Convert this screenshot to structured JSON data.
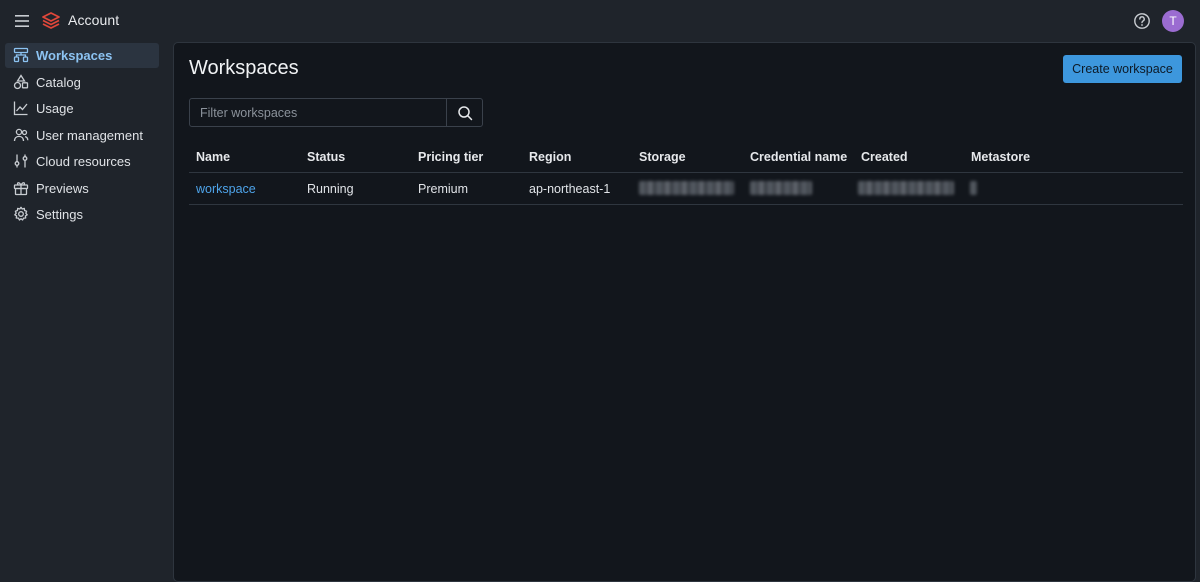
{
  "header": {
    "title": "Account",
    "menu_icon": "hamburger-menu-icon",
    "logo_icon": "stacked-layers-logo",
    "help_icon": "help-circle-icon",
    "avatar_initial": "T",
    "avatar_color": "#9b6cd1"
  },
  "sidebar": {
    "items": [
      {
        "label": "Workspaces",
        "icon": "workspaces-icon",
        "active": true
      },
      {
        "label": "Catalog",
        "icon": "catalog-icon",
        "active": false
      },
      {
        "label": "Usage",
        "icon": "usage-chart-icon",
        "active": false
      },
      {
        "label": "User management",
        "icon": "users-icon",
        "active": false
      },
      {
        "label": "Cloud resources",
        "icon": "cloud-resources-icon",
        "active": false
      },
      {
        "label": "Previews",
        "icon": "gift-icon",
        "active": false
      },
      {
        "label": "Settings",
        "icon": "gear-icon",
        "active": false
      }
    ]
  },
  "main": {
    "title": "Workspaces",
    "create_button_label": "Create workspace",
    "filter": {
      "placeholder": "Filter workspaces",
      "value": ""
    },
    "table": {
      "columns": [
        "Name",
        "Status",
        "Pricing tier",
        "Region",
        "Storage",
        "Credential name",
        "Created",
        "Metastore"
      ],
      "rows": [
        {
          "name": "workspace",
          "status": "Running",
          "pricing_tier": "Premium",
          "region": "ap-northeast-1",
          "storage": "[redacted]",
          "credential_name": "[redacted]",
          "created": "[redacted]",
          "metastore": "[redacted]"
        }
      ]
    }
  },
  "colors": {
    "accent": "#3d97dd",
    "link": "#4ea4ea",
    "active_nav_text": "#8cc3f2",
    "logo_red": "#e0473a"
  }
}
